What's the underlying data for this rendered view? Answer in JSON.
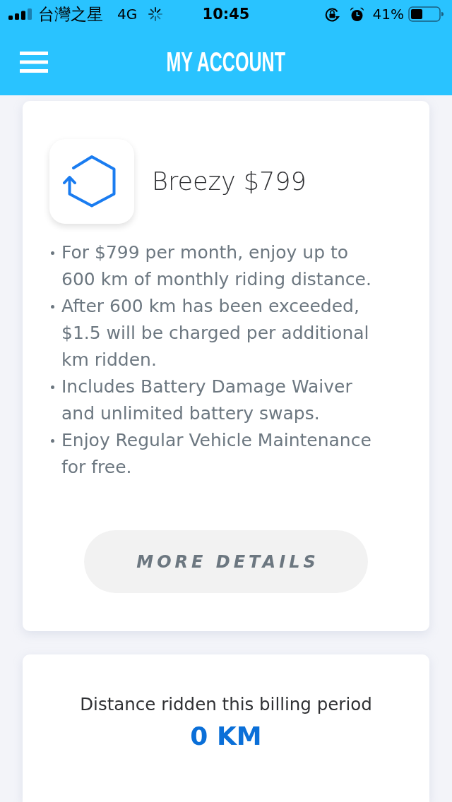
{
  "status_bar": {
    "carrier": "台灣之星",
    "network": "4G",
    "time": "10:45",
    "battery": "41%"
  },
  "header": {
    "title": "MY ACCOUNT"
  },
  "plan_card": {
    "name": "Breezy $799",
    "features": [
      "For $799 per month, enjoy up to 600 km of monthly riding distance.",
      "After 600 km has been exceeded, $1.5 will be charged per additional km ridden.",
      "Includes Battery Damage Waiver and unlimited battery swaps.",
      "Enjoy Regular Vehicle Maintenance for free."
    ],
    "button": "MORE DETAILS"
  },
  "distance_card": {
    "label": "Distance ridden this billing period",
    "value": "0 KM"
  }
}
